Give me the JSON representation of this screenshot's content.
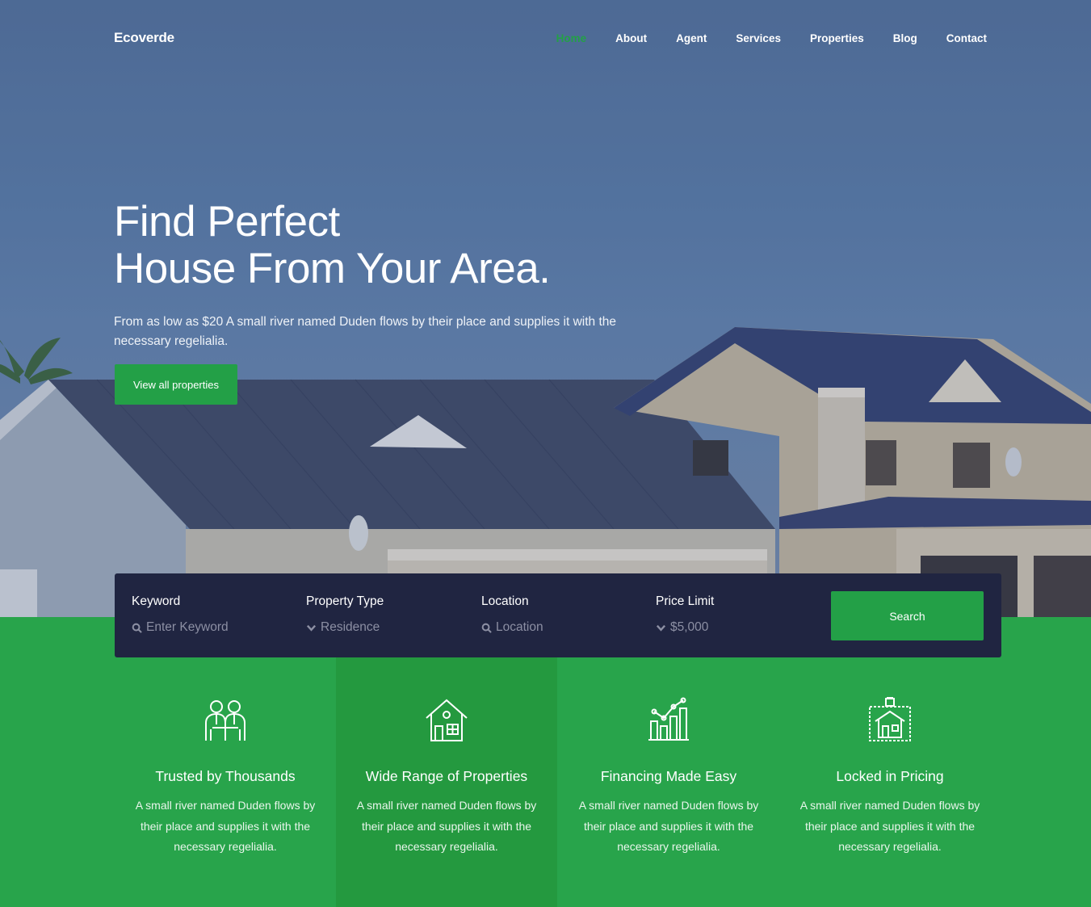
{
  "brand": "Ecoverde",
  "nav": [
    {
      "label": "Home",
      "active": true
    },
    {
      "label": "About",
      "active": false
    },
    {
      "label": "Agent",
      "active": false
    },
    {
      "label": "Services",
      "active": false
    },
    {
      "label": "Properties",
      "active": false
    },
    {
      "label": "Blog",
      "active": false
    },
    {
      "label": "Contact",
      "active": false
    }
  ],
  "hero": {
    "title_line1": "Find Perfect",
    "title_line2": "House From Your Area.",
    "subtitle": "From as low as $20 A small river named Duden flows by their place and supplies it with the necessary regelialia.",
    "cta_label": "View all properties"
  },
  "search": {
    "fields": [
      {
        "label": "Keyword",
        "value": "Enter Keyword",
        "icon": "search-icon"
      },
      {
        "label": "Property Type",
        "value": "Residence",
        "icon": "chevron-down-icon"
      },
      {
        "label": "Location",
        "value": "Location",
        "icon": "search-icon"
      },
      {
        "label": "Price Limit",
        "value": "$5,000",
        "icon": "chevron-down-icon"
      }
    ],
    "button_label": "Search"
  },
  "features": [
    {
      "title": "Trusted by Thousands",
      "text": "A small river named Duden flows by their place and supplies it with the necessary regelialia.",
      "icon": "handshake-people-icon"
    },
    {
      "title": "Wide Range of Properties",
      "text": "A small river named Duden flows by their place and supplies it with the necessary regelialia.",
      "icon": "house-icon"
    },
    {
      "title": "Financing Made Easy",
      "text": "A small river named Duden flows by their place and supplies it with the necessary regelialia.",
      "icon": "chart-growth-icon"
    },
    {
      "title": "Locked in Pricing",
      "text": "A small river named Duden flows by their place and supplies it with the necessary regelialia.",
      "icon": "locked-house-icon"
    }
  ],
  "colors": {
    "accent": "#23a047",
    "features_bg": "#28a44b",
    "search_bg": "#202541"
  }
}
